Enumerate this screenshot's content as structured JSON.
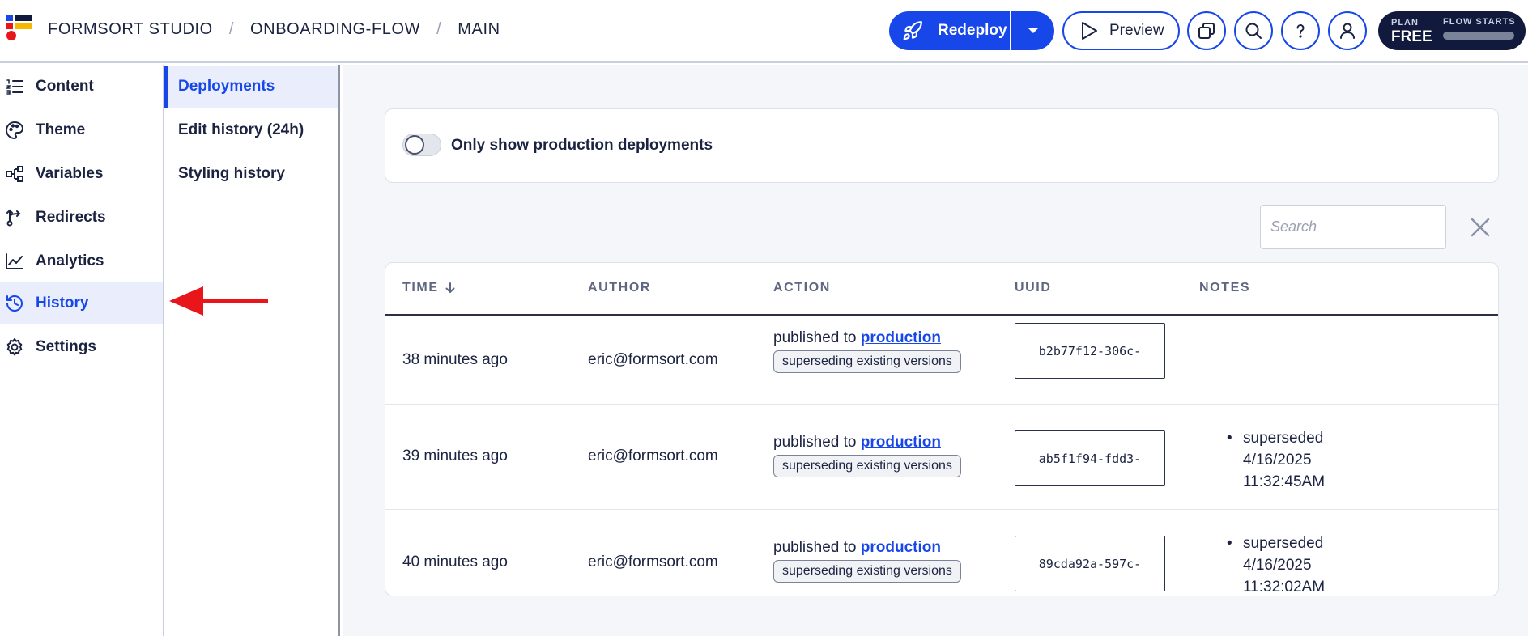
{
  "header": {
    "breadcrumbs": [
      "FORMSORT STUDIO",
      "ONBOARDING-FLOW",
      "MAIN"
    ],
    "separator": "/",
    "redeploy_label": "Redeploy",
    "preview_label": "Preview",
    "plan_label": "PLAN",
    "plan_value": "FREE",
    "flow_starts_label": "FLOW STARTS"
  },
  "sidebar": {
    "items": [
      {
        "label": "Content",
        "icon": "list-ordered-icon"
      },
      {
        "label": "Theme",
        "icon": "palette-icon"
      },
      {
        "label": "Variables",
        "icon": "variables-icon"
      },
      {
        "label": "Redirects",
        "icon": "redirect-icon"
      },
      {
        "label": "Analytics",
        "icon": "chart-line-icon"
      },
      {
        "label": "History",
        "icon": "history-icon",
        "active": true
      },
      {
        "label": "Settings",
        "icon": "gear-icon"
      }
    ]
  },
  "subnav": {
    "items": [
      {
        "label": "Deployments",
        "active": true
      },
      {
        "label": "Edit history (24h)"
      },
      {
        "label": "Styling history"
      }
    ]
  },
  "filter": {
    "toggle_label": "Only show production deployments",
    "toggle_on": false
  },
  "search": {
    "placeholder": "Search",
    "value": ""
  },
  "table": {
    "headers": [
      "TIME",
      "AUTHOR",
      "ACTION",
      "UUID",
      "NOTES"
    ],
    "rows": [
      {
        "time": "38 minutes ago",
        "author": "eric@formsort.com",
        "action_prefix": "published to ",
        "action_link": "production",
        "tag": "superseding existing versions",
        "uuid": "b2b77f12-306c-",
        "notes": []
      },
      {
        "time": "39 minutes ago",
        "author": "eric@formsort.com",
        "action_prefix": "published to ",
        "action_link": "production",
        "tag": "superseding existing versions",
        "uuid": "ab5f1f94-fdd3-",
        "notes": [
          "superseded",
          "4/16/2025",
          "11:32:45AM"
        ]
      },
      {
        "time": "40 minutes ago",
        "author": "eric@formsort.com",
        "action_prefix": "published to ",
        "action_link": "production",
        "tag": "superseding existing versions",
        "uuid": "89cda92a-597c-",
        "notes": [
          "superseded",
          "4/16/2025",
          "11:32:02AM"
        ]
      }
    ]
  },
  "colors": {
    "accent": "#1747e8",
    "navy": "#111a3d",
    "annotation_arrow": "#e8151b"
  }
}
